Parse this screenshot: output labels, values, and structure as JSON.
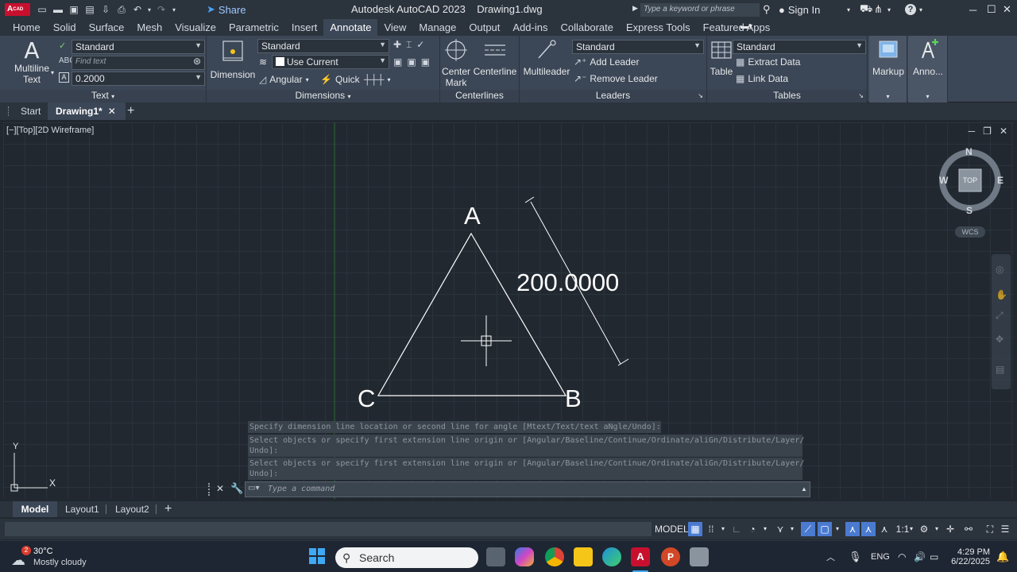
{
  "title_bar": {
    "app_logo": "A",
    "app_logo_sub": "CAD",
    "share_label": "Share",
    "title": "Autodesk AutoCAD 2023    Drawing1.dwg",
    "search_placeholder": "Type a keyword or phrase",
    "sign_in_label": "Sign In",
    "help_label": "?"
  },
  "ribbon_tabs": [
    "Home",
    "Solid",
    "Surface",
    "Mesh",
    "Visualize",
    "Parametric",
    "Insert",
    "Annotate",
    "View",
    "Manage",
    "Output",
    "Add-ins",
    "Collaborate",
    "Express Tools",
    "Featured Apps"
  ],
  "active_ribbon_tab": "Annotate",
  "ribbon": {
    "text_panel": {
      "title": "Text",
      "multiline_label_1": "Multiline",
      "multiline_label_2": "Text",
      "style_value": "Standard",
      "find_placeholder": "Find text",
      "height_value": "0.2000"
    },
    "dimensions_panel": {
      "title": "Dimensions",
      "dimension_label": "Dimension",
      "dimstyle_value": "Standard",
      "layer_value": "Use Current",
      "angular_label": "Angular",
      "quick_label": "Quick"
    },
    "centerlines_panel": {
      "title": "Centerlines",
      "center_mark_label": "Center",
      "center_mark_label_2": "Mark",
      "centerline_label": "Centerline"
    },
    "leaders_panel": {
      "title": "Leaders",
      "multileader_label": "Multileader",
      "style_value": "Standard",
      "add_leader_label": "Add Leader",
      "remove_leader_label": "Remove Leader"
    },
    "tables_panel": {
      "title": "Tables",
      "table_label": "Table",
      "style_value": "Standard",
      "extract_data_label": "Extract Data",
      "link_data_label": "Link Data"
    },
    "markup_label": "Markup",
    "anno_label": "Anno..."
  },
  "file_tabs": {
    "start_label": "Start",
    "drawing_label": "Drawing1*",
    "add_label": "+"
  },
  "viewport": {
    "label": "[−][Top][2D Wireframe]",
    "points": {
      "a": "A",
      "b": "B",
      "c": "C"
    },
    "dimension_text": "200.0000",
    "viewcube": {
      "top": "TOP",
      "n": "N",
      "s": "S",
      "e": "E",
      "w": "W"
    },
    "wcs_label": "WCS",
    "ucs_x": "X",
    "ucs_y": "Y"
  },
  "command_history": [
    "Specify dimension line location or second line for angle [Mtext/Text/text aNgle/Undo]:",
    "Select objects or specify first extension line origin or [Angular/Baseline/Continue/Ordinate/aliGn/Distribute/Layer/\nUndo]:",
    "Select objects or specify first extension line origin or [Angular/Baseline/Continue/Ordinate/aliGn/Distribute/Layer/\nUndo]:"
  ],
  "command_placeholder": "Type a command",
  "layout_tabs": {
    "model": "Model",
    "layout1": "Layout1",
    "layout2": "Layout2",
    "add": "+"
  },
  "status_bar": {
    "model_label": "MODEL",
    "scale_label": "1:1"
  },
  "taskbar": {
    "weather_badge": "2",
    "temperature": "30°C",
    "weather_desc": "Mostly cloudy",
    "search_label": "Search",
    "language": "ENG",
    "time": "4:29 PM",
    "date": "6/22/2025"
  },
  "colors": {
    "accent_blue": "#4a7bd0",
    "app_red": "#c8102e",
    "ribbon_bg": "#3b4656",
    "canvas_bg": "#212830"
  }
}
